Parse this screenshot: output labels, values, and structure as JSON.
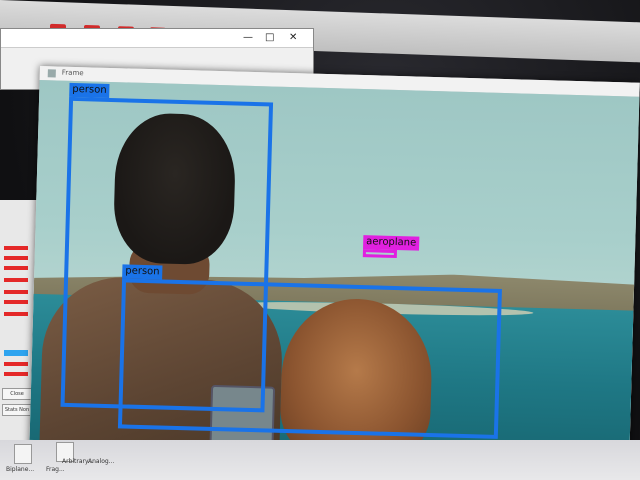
{
  "window": {
    "title": "Frame"
  },
  "left_panel": {
    "button_1": "Stats Non",
    "button_2": "Close"
  },
  "detections": [
    {
      "label": "person",
      "color": "#1a73e8"
    },
    {
      "label": "person",
      "color": "#1a73e8"
    },
    {
      "label": "aeroplane",
      "color": "#e020e0"
    }
  ],
  "desktop_icons": [
    {
      "label": "Biplane..."
    },
    {
      "label": "Frag..."
    },
    {
      "label": "Arbitrary..."
    },
    {
      "label": "Analog..."
    }
  ]
}
